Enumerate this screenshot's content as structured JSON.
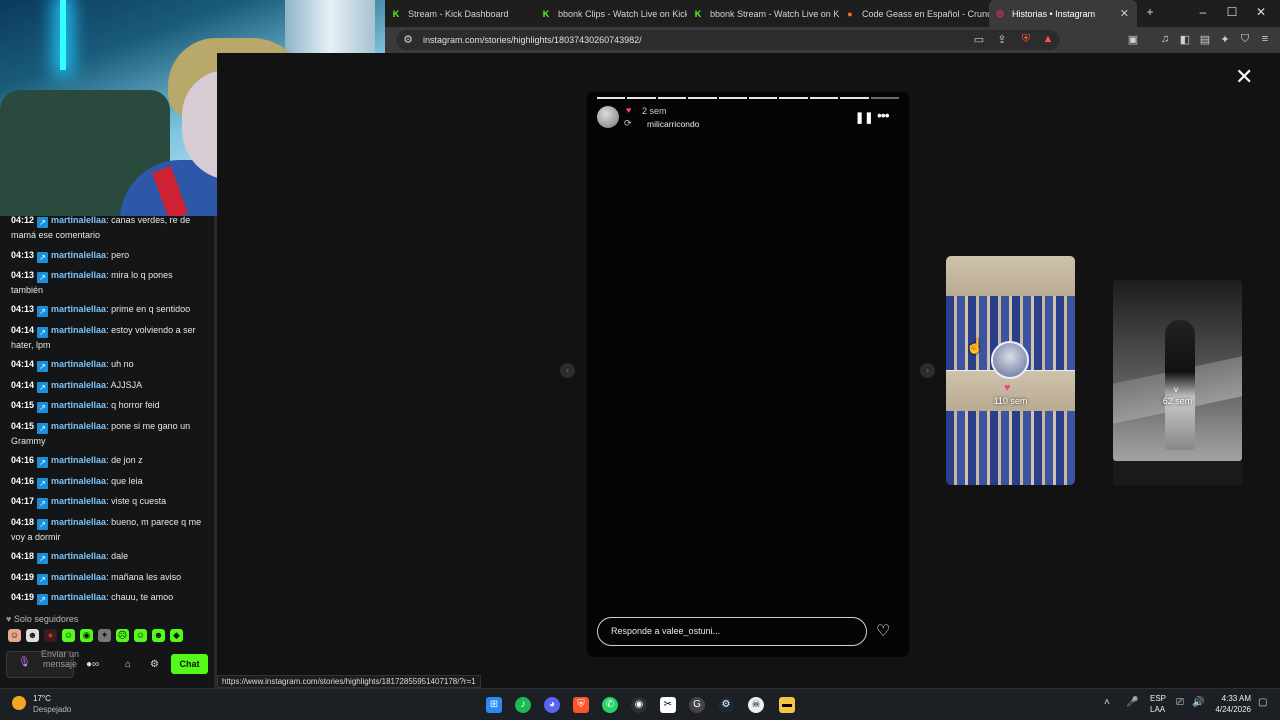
{
  "browser": {
    "tabs": [
      {
        "label": "Stream - Kick Dashboard",
        "icon": "kick-icon",
        "color": "#53fc18"
      },
      {
        "label": "bbonk Clips - Watch Live on Kick",
        "icon": "kick-icon",
        "color": "#53fc18"
      },
      {
        "label": "bbonk Stream - Watch Live on Kick",
        "icon": "kick-icon",
        "color": "#53fc18"
      },
      {
        "label": "Code Geass en Español - Crunchy",
        "icon": "crunchyroll-icon",
        "color": "#f47521"
      },
      {
        "label": "Historias • Instagram",
        "icon": "instagram-icon",
        "color": "#e1306c"
      }
    ],
    "url": "instagram.com/stories/highlights/18037430260743982/",
    "status_url": "https://www.instagram.com/stories/highlights/18172855951407178/?r=1"
  },
  "chat": {
    "messages": [
      {
        "time": "04:12",
        "user": "martinalellaa",
        "text": "canas verdes, re de mamá ese comentario"
      },
      {
        "time": "04:13",
        "user": "martinalellaa",
        "text": "pero"
      },
      {
        "time": "04:13",
        "user": "martinalellaa",
        "text": "mira lo q pones también"
      },
      {
        "time": "04:13",
        "user": "martinalellaa",
        "text": "prime en q sentidoo"
      },
      {
        "time": "04:14",
        "user": "martinalellaa",
        "text": "estoy volviendo a ser hater, lpm"
      },
      {
        "time": "04:14",
        "user": "martinalellaa",
        "text": "uh no"
      },
      {
        "time": "04:14",
        "user": "martinalellaa",
        "text": "AJJSJA"
      },
      {
        "time": "04:15",
        "user": "martinalellaa",
        "text": "q horror feid"
      },
      {
        "time": "04:15",
        "user": "martinalellaa",
        "text": "pone si me gano un Grammy"
      },
      {
        "time": "04:16",
        "user": "martinalellaa",
        "text": "de jon z"
      },
      {
        "time": "04:16",
        "user": "martinalellaa",
        "text": "que leia"
      },
      {
        "time": "04:17",
        "user": "martinalellaa",
        "text": "viste q cuesta"
      },
      {
        "time": "04:18",
        "user": "martinalellaa",
        "text": "bueno, m parece q me voy a dormir"
      },
      {
        "time": "04:18",
        "user": "martinalellaa",
        "text": "dale"
      },
      {
        "time": "04:19",
        "user": "martinalellaa",
        "text": "mañana les aviso"
      },
      {
        "time": "04:19",
        "user": "martinalellaa",
        "text": "chauu, te amoo"
      }
    ],
    "followers_mode": "Solo seguidores",
    "send_placeholder": "Enviar un mensaje",
    "chat_button": "Chat"
  },
  "story": {
    "time_ago": "2 sem",
    "username": "milicarricondo",
    "reply_placeholder": "Responde a valee_ostuni...",
    "segments_total": 10,
    "segments_viewed": 9
  },
  "previews": [
    {
      "label": "110 sem"
    },
    {
      "label": "62 sem"
    }
  ],
  "taskbar": {
    "temp": "17°C",
    "condition": "Despejado",
    "lang1": "ESP",
    "lang2": "LAA",
    "time": "4:33 AM",
    "date": "4/24/2026"
  }
}
